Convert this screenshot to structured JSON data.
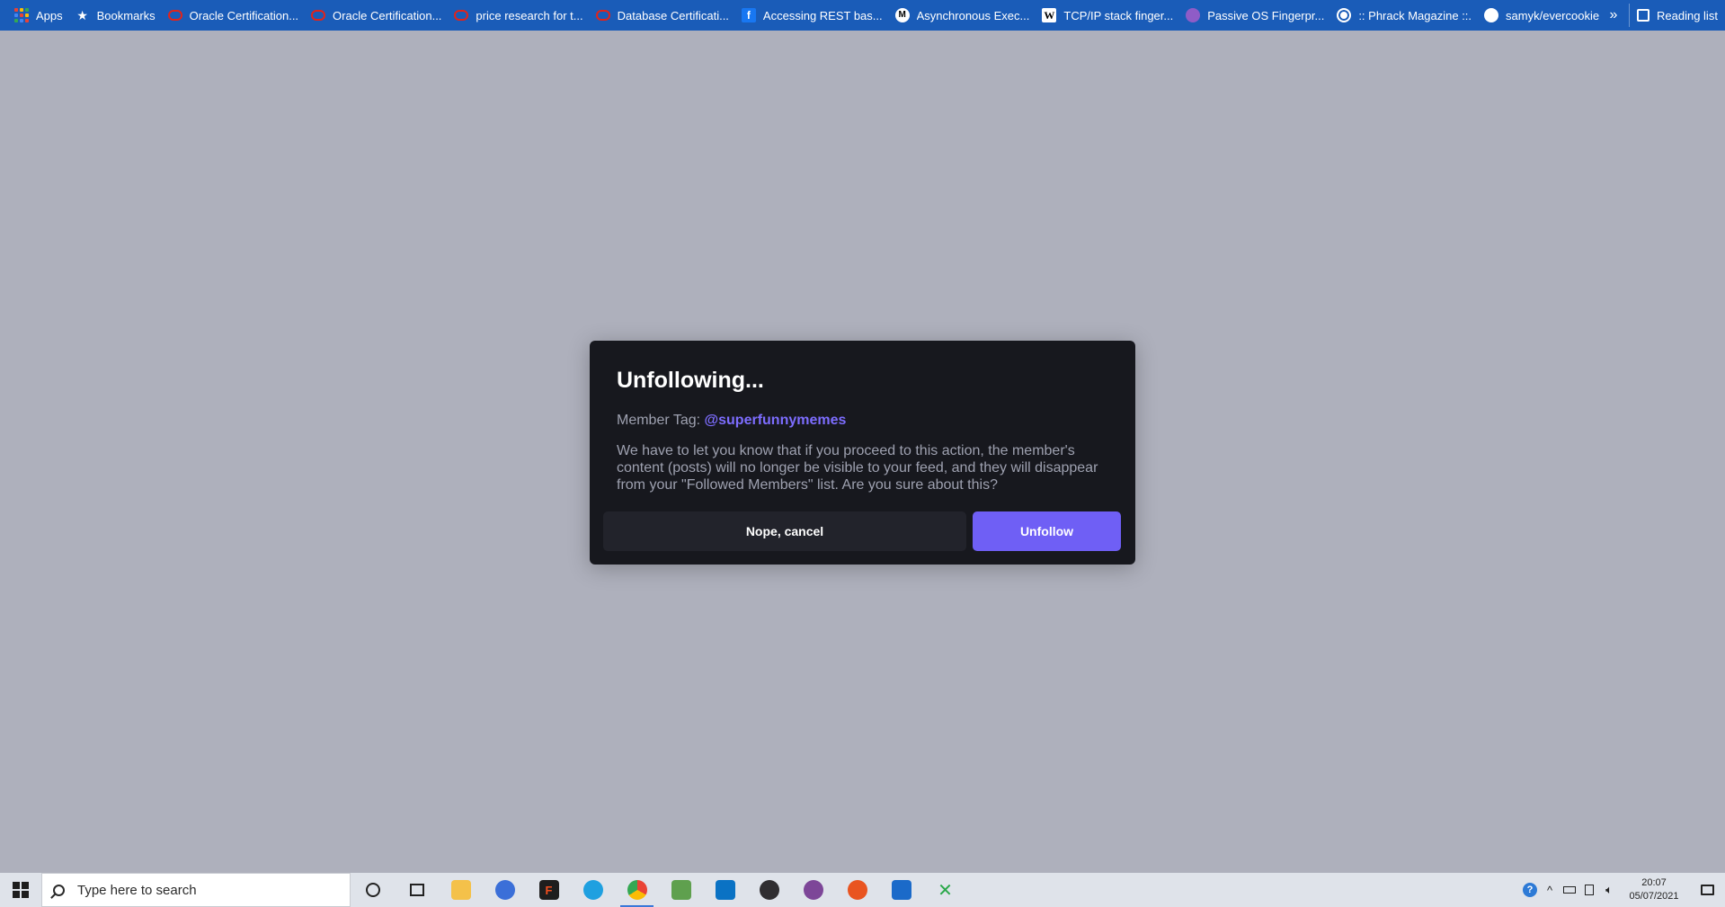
{
  "bookmarks_bar": {
    "items": [
      {
        "label": "Apps",
        "icon": "apps-grid-icon"
      },
      {
        "label": "Bookmarks",
        "icon": "star-icon"
      },
      {
        "label": "Oracle Certification...",
        "icon": "oracle-icon"
      },
      {
        "label": "Oracle Certification...",
        "icon": "oracle-icon"
      },
      {
        "label": "price research for t...",
        "icon": "oracle-icon"
      },
      {
        "label": "Database Certificati...",
        "icon": "oracle-icon"
      },
      {
        "label": "Accessing REST bas...",
        "icon": "facebook-icon"
      },
      {
        "label": "Asynchronous Exec...",
        "icon": "medium-icon"
      },
      {
        "label": "TCP/IP stack finger...",
        "icon": "wikipedia-icon"
      },
      {
        "label": "Passive OS Fingerpr...",
        "icon": "passive-os-icon"
      },
      {
        "label": ":: Phrack Magazine ::.",
        "icon": "globe-icon"
      },
      {
        "label": "samyk/evercookie",
        "icon": "github-icon"
      }
    ],
    "more_label": "»",
    "reading_list_label": "Reading list"
  },
  "modal": {
    "title": "Unfollowing...",
    "member_tag_label": "Member Tag:",
    "member_handle": "@superfunnymemes",
    "body": "We have to let you know that if you proceed to this action, the member's content (posts) will no longer be visible to your feed, and they will disappear from your \"Followed Members\" list. Are you sure about this?",
    "cancel_label": "Nope, cancel",
    "confirm_label": "Unfollow"
  },
  "taskbar": {
    "search_placeholder": "Type here to search",
    "clock_time": "20:07",
    "clock_date": "05/07/2021"
  },
  "colors": {
    "bookmarks_bar_bg": "#1a5cb8",
    "overlay_bg": "#aeb0bc",
    "modal_bg": "#17181e",
    "accent": "#6f5ff5",
    "handle": "#7d6dff"
  }
}
